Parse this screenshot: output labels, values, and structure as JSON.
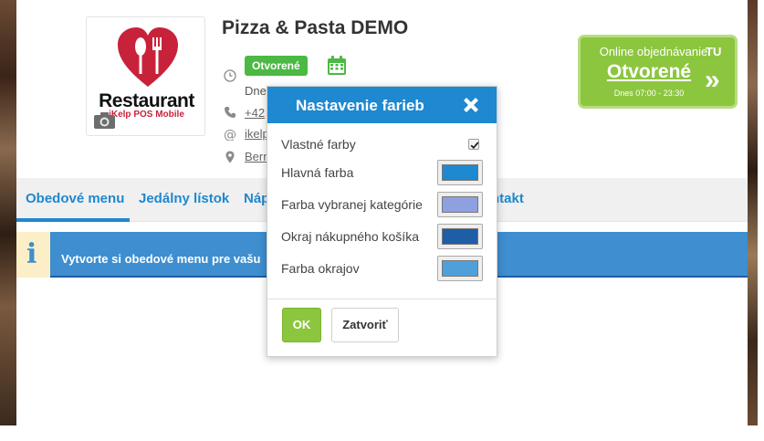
{
  "restaurant": {
    "name": "Pizza & Pasta DEMO",
    "logo_text": "Restaurant",
    "logo_subtext": "iKelp POS Mobile",
    "status_badge": "Otvorené",
    "hours_prefix": "Dne",
    "phone_prefix": "+42",
    "email_prefix": "ikelp",
    "address_prefix": "Bern"
  },
  "online_order": {
    "title": "Online objednávanie",
    "title_suffix": "TU",
    "status": "Otvorené",
    "hours": "Dnes 07:00 - 23:30",
    "arrow": "»",
    "accent_color": "#8cc63f"
  },
  "nav": {
    "items": [
      "Obedové menu",
      "Jedálny lístok",
      "Náp",
      "ntakt"
    ],
    "active_index": 0,
    "color": "#1e88d0"
  },
  "notice": {
    "text": "Vytvorte si obedové menu pre vašu",
    "icon_char": "i"
  },
  "modal": {
    "title": "Nastavenie farieb",
    "fields": {
      "custom_colors": "Vlastné farby",
      "main_color": "Hlavná farba",
      "selected_category_color": "Farba vybranej kategórie",
      "cart_border": "Okraj nákupného košíka",
      "border_color": "Farba okrajov"
    },
    "custom_colors_checked": true,
    "colors": {
      "main": "#1e88d0",
      "selected_category": "#8fa0e0",
      "cart_border": "#1d5ea6",
      "border": "#4f9fdb"
    },
    "ok_label": "OK",
    "close_label": "Zatvoriť"
  }
}
